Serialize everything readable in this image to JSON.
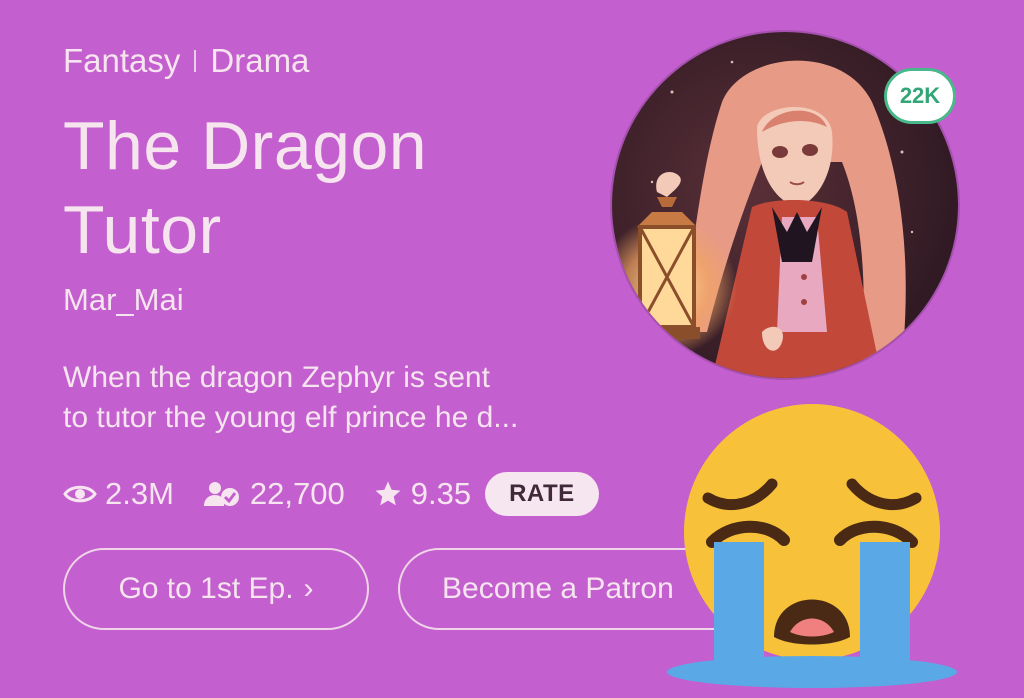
{
  "genres": [
    "Fantasy",
    "Drama"
  ],
  "title_lines": [
    "The Dragon",
    "Tutor"
  ],
  "author": "Mar_Mai",
  "description_lines": [
    "When the dragon Zephyr is sent",
    "to tutor the young elf prince he d..."
  ],
  "stats": {
    "views": "2.3M",
    "subscribers": "22,700",
    "rating": "9.35",
    "rate_label": "RATE"
  },
  "buttons": {
    "first_episode": "Go to 1st Ep.",
    "first_episode_chevron": "›",
    "patron": "Become a Patron"
  },
  "cover": {
    "badge": "22K"
  },
  "icons": {
    "views": "eye-icon",
    "subscribers": "subscriber-check-icon",
    "rating": "star-icon",
    "overlay": "loudly-crying-face-emoji"
  },
  "colors": {
    "background": "#c35fce",
    "text": "#f6e4ef",
    "badge_accent": "#49b88b",
    "emoji_face": "#f7c23a",
    "emoji_tears": "#5aa9e6"
  }
}
